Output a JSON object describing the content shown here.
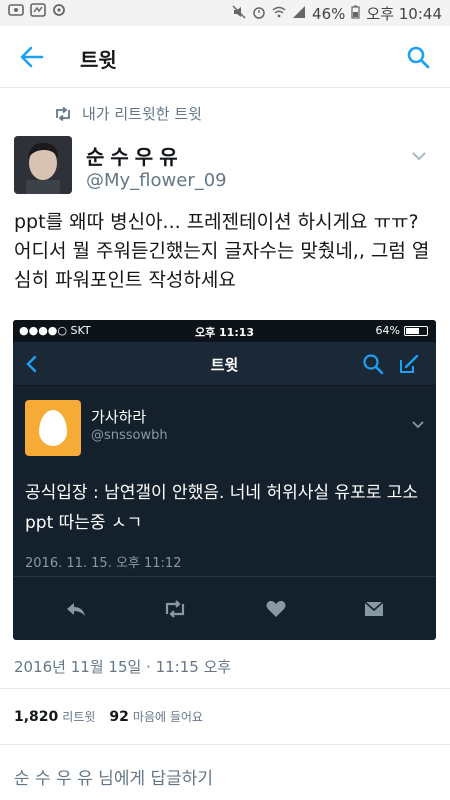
{
  "status_bar": {
    "battery": "46%",
    "time": "오후 10:44"
  },
  "header": {
    "title": "트윗"
  },
  "retweet_context": {
    "text": "내가 리트윗한 트윗"
  },
  "tweet": {
    "display_name": "순수우유",
    "handle": "@My_flower_09",
    "text": "ppt를 왜따 병신아... 프레젠테이션 하시게요 ㅠㅠ? 어디서 뭘 주워듣긴했는지 글자수는 맞췄네,, 그럼 열심히 파워포인트 작성하세요",
    "timestamp": "2016년 11월 15일 · 11:15 오후",
    "retweet_count": "1,820",
    "retweet_label": "리트윗",
    "like_count": "92",
    "like_label": "마음에 들어요"
  },
  "embedded": {
    "carrier": "●●●●○ SKT",
    "time": "오후 11:13",
    "battery": "64%",
    "battery_level": 0.64,
    "nav_title": "트윗",
    "name": "가사하라",
    "handle": "@snssowbh",
    "text": "공식입장 : 남연갤이 안했음. 너네 허위사실 유포로 고소 ppt 따는중 ㅅㄱ",
    "date": "2016. 11. 15. 오후 11:12"
  },
  "reply": {
    "prompt": "순 수 우 유 님에게 답글하기"
  },
  "colors": {
    "accent": "#1da1f2",
    "embed_bg": "#14202b",
    "egg_avatar": "#f5ab35"
  }
}
